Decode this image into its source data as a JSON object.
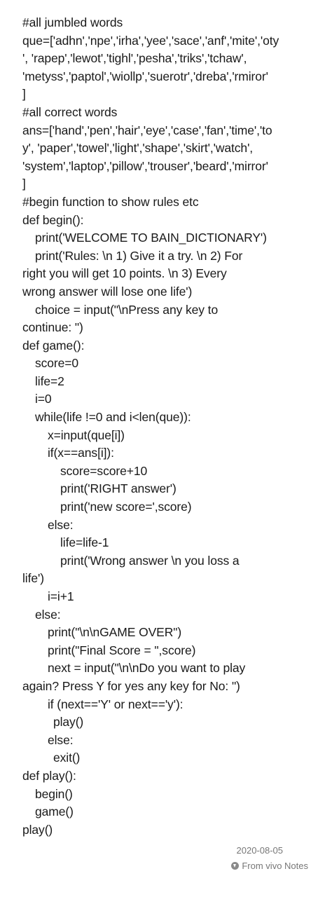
{
  "note": {
    "lines": [
      "#all jumbled words",
      "que=['adhn','npe','irha','yee','sace','anf','mite','oty",
      "', 'rapep','lewot','tighl','pesha','triks','tchaw',",
      "'metyss','paptol','wiollp','suerotr','dreba','rmiror'",
      "]",
      "#all correct words",
      "ans=['hand','pen','hair','eye','case','fan','time','to",
      "y', 'paper','towel','light','shape','skirt','watch',",
      "'system','laptop','pillow','trouser','beard','mirror'",
      "]",
      "#begin function to show rules etc",
      "def begin():",
      "print('WELCOME TO BAIN_DICTIONARY')",
      "print('Rules: \\n 1) Give it a try. \\n 2) For",
      "right you will get 10 points. \\n 3) Every",
      "wrong answer will lose one life')",
      "choice = input(\"\\nPress any key to",
      "continue: \")",
      "def game():",
      "score=0",
      "life=2",
      "i=0",
      "while(life !=0 and i<len(que)):",
      "x=input(que[i])",
      "if(x==ans[i]):",
      "score=score+10",
      "print('RIGHT answer')",
      "print('new score=',score)",
      "else:",
      "life=life-1",
      "print('Wrong answer \\n you loss a",
      "life')",
      "i=i+1",
      "else:",
      "print(\"\\n\\nGAME OVER\")",
      "print(\"Final Score = \",score)",
      "next = input(\"\\n\\nDo you want to play",
      "again? Press Y for yes any key for No: \")",
      "if (next=='Y' or next=='y'):",
      "play()",
      "else:",
      "exit()",
      "def play():",
      "begin()",
      "game()",
      "play()"
    ]
  },
  "footer": {
    "date": "2020-08-05",
    "source": "From vivo Notes",
    "source_icon": "vivo-logo-icon"
  }
}
